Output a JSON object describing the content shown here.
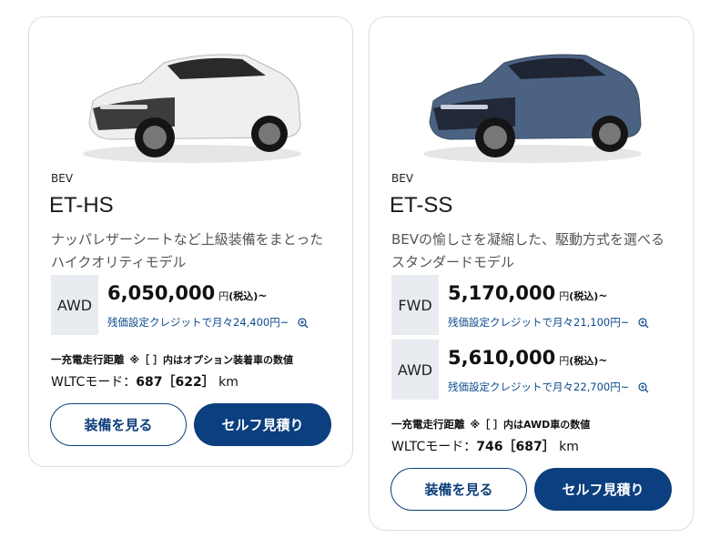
{
  "cards": [
    {
      "fuel": "BEV",
      "name": "ET-HS",
      "desc": "ナッパレザーシートなど上級装備をまとったハイクオリティモデル",
      "car_color": "#f2f2f2",
      "variants": [
        {
          "drive": "AWD",
          "price": "6,050,000",
          "unit": "円",
          "tax": "(税込)",
          "tilde": "~",
          "credit": "残価設定クレジットで月々24,400円~"
        }
      ],
      "range_title": "一充電走行距離",
      "range_note": "※［ ］内はオプション装着車の数値",
      "range_label": "WLTCモード：",
      "range_value": "687［622］",
      "range_unit": "km",
      "equip_button": "装備を見る",
      "quote_button": "セルフ見積り"
    },
    {
      "fuel": "BEV",
      "name": "ET-SS",
      "desc": "BEVの愉しさを凝縮した、駆動方式を選べるスタンダードモデル",
      "car_color": "#4c6283",
      "variants": [
        {
          "drive": "FWD",
          "price": "5,170,000",
          "unit": "円",
          "tax": "(税込)",
          "tilde": "~",
          "credit": "残価設定クレジットで月々21,100円~"
        },
        {
          "drive": "AWD",
          "price": "5,610,000",
          "unit": "円",
          "tax": "(税込)",
          "tilde": "~",
          "credit": "残価設定クレジットで月々22,700円~"
        }
      ],
      "range_title": "一充電走行距離",
      "range_note": "※［ ］内はAWD車の数値",
      "range_label": "WLTCモード：",
      "range_value": "746［687］",
      "range_unit": "km",
      "equip_button": "装備を見る",
      "quote_button": "セルフ見積り"
    }
  ]
}
